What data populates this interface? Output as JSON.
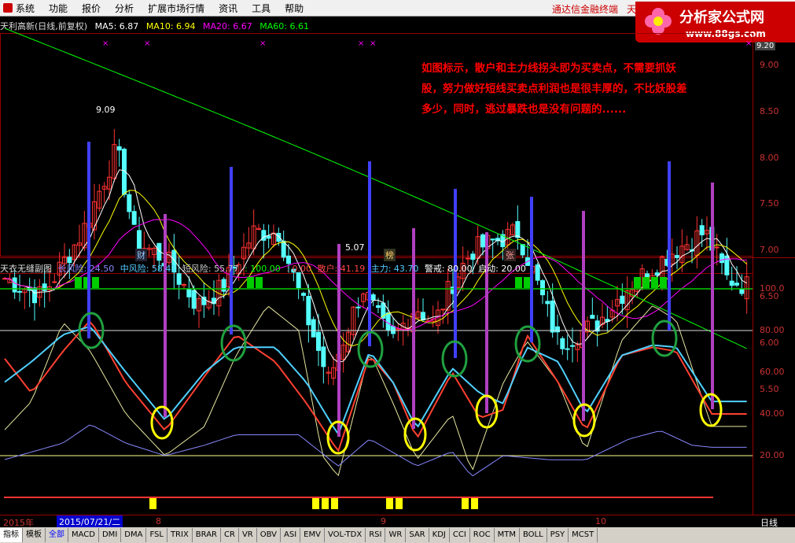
{
  "menubar": {
    "items": [
      "系统",
      "功能",
      "报价",
      "分析",
      "扩展市场行情",
      "资讯",
      "工具",
      "帮助"
    ],
    "right_text": "通达信金融终端",
    "right_text2": "天"
  },
  "logo": {
    "title": "分析家公式网",
    "url": "www.88gs.com"
  },
  "price_panel": {
    "title": "天利高新(日线,前复权)",
    "ma5": "MA5: 6.87",
    "ma10": "MA10: 6.94",
    "ma20": "MA20: 6.67",
    "ma60": "MA60: 6.61",
    "ticks": [
      "9.00",
      "8.50",
      "8.00",
      "7.50",
      "7.00",
      "6.50",
      "6.00",
      "5.50"
    ],
    "high_label": "9.09",
    "low_label": "5.07",
    "top_label": "9.20",
    "markers": [
      "财",
      "榜",
      "张"
    ]
  },
  "annotation": "如图标示，散户和主力线拐头即为买卖点，不需要抓妖股，努力做好短线买卖点利润也是很丰厚的，不比妖股差多少，同时，逃过暴跌也是没有问题的......",
  "indicator_panel": {
    "name": "天衣无缝副图",
    "long_risk": "长风险: 24.50",
    "mid_risk": "中风险: 58.41",
    "short_risk": "短风险: 55.77",
    "v1": ": 100.00",
    "v2": ": 0.00",
    "retail": "散户: 41.19",
    "main": "主力: 43.70",
    "alert": "警戒: 80.00",
    "start": "启动: 20.00",
    "ticks": [
      "100.0",
      "80.00",
      "60.00",
      "40.00",
      "20.00"
    ]
  },
  "date_bar": {
    "year": "2015年",
    "selected_date": "2015/07/21/二",
    "months": [
      "8",
      "9",
      "10"
    ],
    "period": "日线"
  },
  "tabs": [
    "指标",
    "模板",
    "全部",
    "MACD",
    "DMI",
    "DMA",
    "FSL",
    "TRIX",
    "BRAR",
    "CR",
    "VR",
    "OBV",
    "ASI",
    "EMV",
    "VOL-TDX",
    "RSI",
    "WR",
    "SAR",
    "KDJ",
    "CCI",
    "ROC",
    "MTM",
    "BOLL",
    "PSY",
    "MCST"
  ],
  "colors": {
    "up": "#ff3232",
    "down": "#54ffff",
    "ma5": "#ffffff",
    "ma10": "#ffff00",
    "ma20": "#ff00ff",
    "ma60": "#00ff00",
    "blue_line": "#4040ff",
    "purple_line": "#b040c0",
    "green_ellipse": "#20a040",
    "yellow_ellipse": "#ffff00"
  }
}
